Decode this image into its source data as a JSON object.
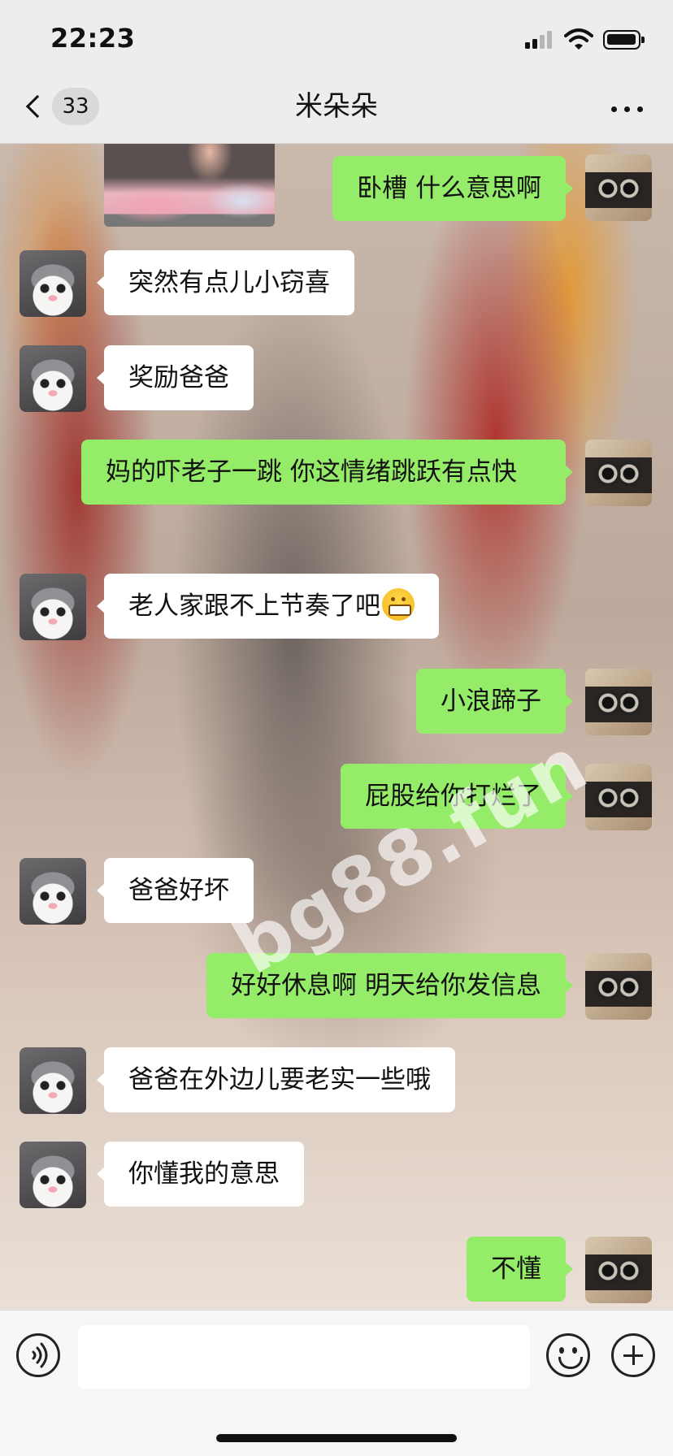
{
  "status_bar": {
    "time": "22:23",
    "icons": [
      "cellular-signal-icon",
      "wifi-icon",
      "battery-icon"
    ]
  },
  "nav": {
    "back_icon": "chevron-left-icon",
    "unread_count": "33",
    "title": "米朵朵",
    "more_icon": "more-horizontal-icon"
  },
  "colors": {
    "outgoing_bubble": "#95ec69",
    "incoming_bubble": "#ffffff",
    "bar_background": "#ededed"
  },
  "messages": [
    {
      "side": "out",
      "text": "卧槽 什么意思啊"
    },
    {
      "side": "in",
      "text": "突然有点儿小窃喜"
    },
    {
      "side": "in",
      "text": "奖励爸爸"
    },
    {
      "side": "out",
      "text": "妈的吓老子一跳 你这情绪跳跃有点快"
    },
    {
      "side": "in",
      "text": "老人家跟不上节奏了吧",
      "emoji": "grinning-face-icon"
    },
    {
      "side": "out",
      "text": "小浪蹄子"
    },
    {
      "side": "out",
      "text": "屁股给你打烂了"
    },
    {
      "side": "in",
      "text": "爸爸好坏"
    },
    {
      "side": "out",
      "text": "好好休息啊 明天给你发信息"
    },
    {
      "side": "in",
      "text": "爸爸在外边儿要老实一些哦"
    },
    {
      "side": "in",
      "text": "你懂我的意思"
    },
    {
      "side": "out",
      "text": "不懂"
    }
  ],
  "watermark": "bg88.fun",
  "input_bar": {
    "voice_icon": "voice-input-icon",
    "input_value": "",
    "emoji_icon": "emoji-icon",
    "plus_icon": "plus-icon"
  }
}
